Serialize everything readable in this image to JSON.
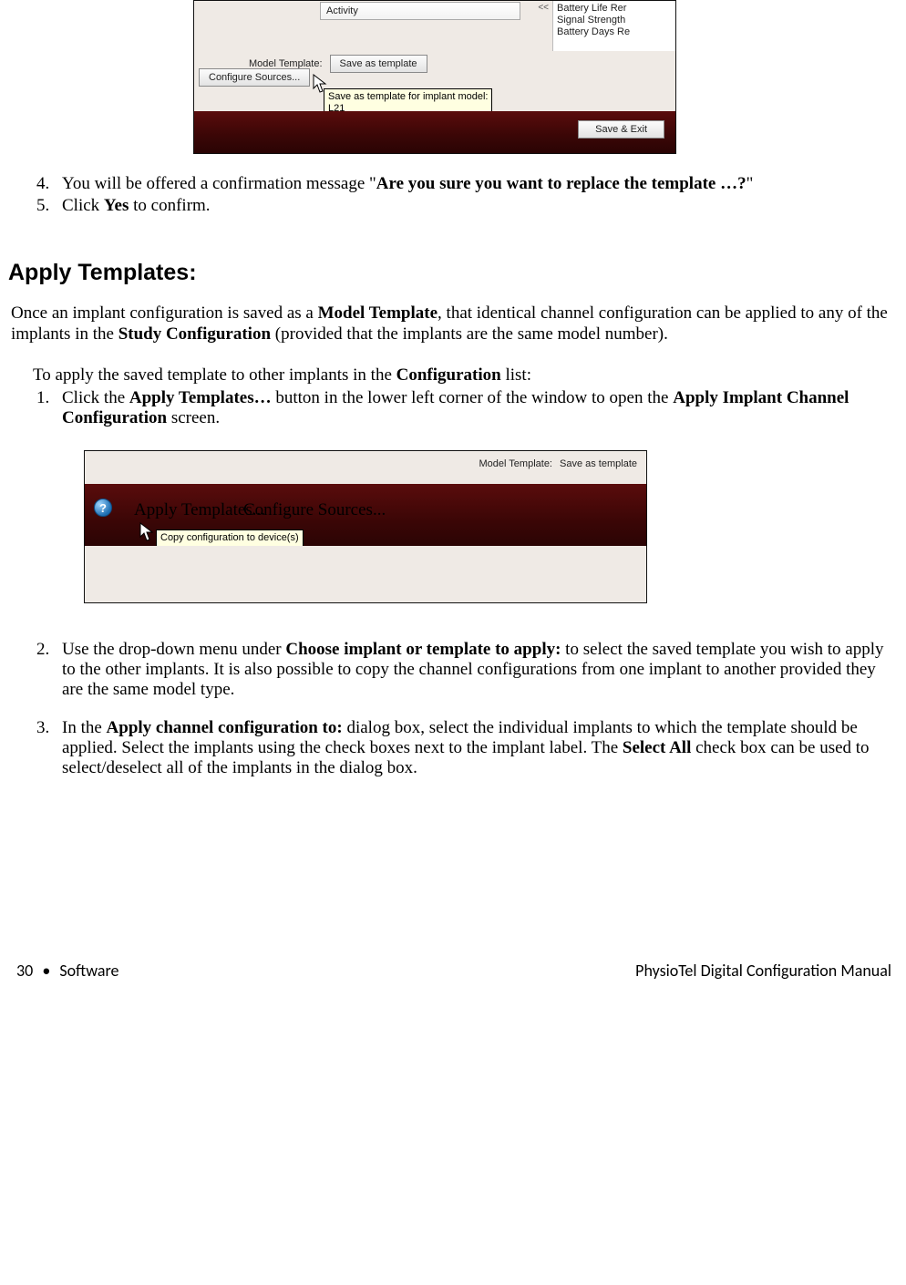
{
  "shot1": {
    "activity": "Activity",
    "arrows": "<<",
    "right_lines": [
      "Battery Life Rer",
      "Signal Strength",
      "Battery Days Re"
    ],
    "model_template_label": "Model Template:",
    "save_as_template": "Save as template",
    "configure_sources": "Configure Sources...",
    "tooltip_line1": "Save as template for implant model:",
    "tooltip_line2": "L21",
    "save_exit": "Save & Exit"
  },
  "steps_a": {
    "n4": "4.",
    "t4a": "You will be offered a confirmation message \"",
    "t4b": "Are you sure you want to replace the template …?",
    "t4c": "\"",
    "n5": "5.",
    "t5a": "Click ",
    "t5b": "Yes",
    "t5c": " to confirm."
  },
  "heading": "Apply Templates:",
  "para1": {
    "a": "Once an implant configuration is saved as a ",
    "b": "Model Template",
    "c": ", that identical channel configuration can be applied to any of the implants in the ",
    "d": "Study Configuration",
    "e": " (provided that the implants are the same model number)."
  },
  "lead": {
    "a": "To apply the saved template to other implants in the ",
    "b": "Configuration",
    "c": " list:"
  },
  "steps_b": {
    "n1": "1.",
    "t1a": "Click the ",
    "t1b": "Apply Templates…",
    "t1c": " button in the lower left corner of the window to open the ",
    "t1d": "Apply Implant Channel Configuration",
    "t1e": " screen."
  },
  "shot2": {
    "model_template_label": "Model Template:",
    "save_as_template": "Save as template",
    "help": "?",
    "apply_templates": "Apply Templates...",
    "configure_sources": "Configure Sources...",
    "tooltip": "Copy configuration to device(s)"
  },
  "steps_c": {
    "n2": "2.",
    "t2a": "Use the drop-down menu under ",
    "t2b": "Choose implant or template to apply:",
    "t2c": " to select the saved template you wish to apply to the other implants. It is also possible to copy the channel configurations from one implant to another provided they are the same model type.",
    "n3": "3.",
    "t3a": "In the ",
    "t3b": "Apply channel configuration to:",
    "t3c": " dialog box, select the individual implants to which the template should be applied. Select the implants using the check boxes next to the implant label. The ",
    "t3d": "Select All",
    "t3e": " check box can be used to select/deselect all of the implants in the dialog box."
  },
  "footer": {
    "page_num": "30",
    "section": "Software",
    "title": "PhysioTel Digital Configuration Manual"
  }
}
